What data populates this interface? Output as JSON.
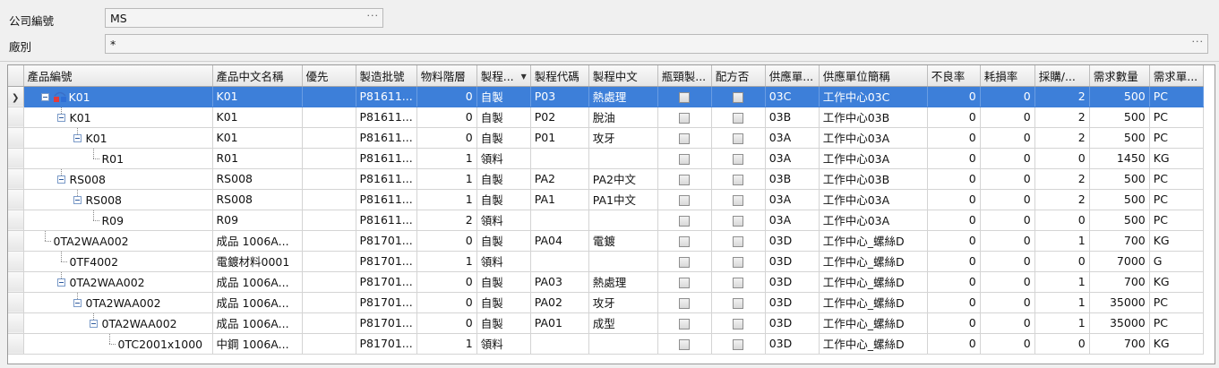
{
  "filters": {
    "company_label": "公司編號",
    "company_value": "MS",
    "plant_label": "廠別",
    "plant_value": "*",
    "ellipsis": "···"
  },
  "grid": {
    "columns": [
      "產品編號",
      "產品中文名稱",
      "優先",
      "製造批號",
      "物料階層",
      "製程...",
      "製程代碼",
      "製程中文",
      "瓶頸製...",
      "配方否",
      "供應單...",
      "供應單位簡稱",
      "不良率",
      "耗損率",
      "採購/...",
      "需求數量",
      "需求單..."
    ],
    "rows": [
      {
        "code": "K01",
        "name": "K01",
        "priority": "",
        "lot": "P81611...",
        "level": "0",
        "ptype": "自製",
        "pcode": "P03",
        "pname": "熱處理",
        "supplier": "03C",
        "supplier_name": "工作中心03C",
        "defect": "0",
        "loss": "0",
        "purchase": "2",
        "qty": "500",
        "unit": "PC"
      },
      {
        "code": "K01",
        "name": "K01",
        "priority": "",
        "lot": "P81611...",
        "level": "0",
        "ptype": "自製",
        "pcode": "P02",
        "pname": "脫油",
        "supplier": "03B",
        "supplier_name": "工作中心03B",
        "defect": "0",
        "loss": "0",
        "purchase": "2",
        "qty": "500",
        "unit": "PC"
      },
      {
        "code": "K01",
        "name": "K01",
        "priority": "",
        "lot": "P81611...",
        "level": "0",
        "ptype": "自製",
        "pcode": "P01",
        "pname": "攻牙",
        "supplier": "03A",
        "supplier_name": "工作中心03A",
        "defect": "0",
        "loss": "0",
        "purchase": "2",
        "qty": "500",
        "unit": "PC"
      },
      {
        "code": "R01",
        "name": "R01",
        "priority": "",
        "lot": "P81611...",
        "level": "1",
        "ptype": "領料",
        "pcode": "",
        "pname": "",
        "supplier": "03A",
        "supplier_name": "工作中心03A",
        "defect": "0",
        "loss": "0",
        "purchase": "0",
        "qty": "1450",
        "unit": "KG"
      },
      {
        "code": "RS008",
        "name": "RS008",
        "priority": "",
        "lot": "P81611...",
        "level": "1",
        "ptype": "自製",
        "pcode": "PA2",
        "pname": "PA2中文",
        "supplier": "03B",
        "supplier_name": "工作中心03B",
        "defect": "0",
        "loss": "0",
        "purchase": "2",
        "qty": "500",
        "unit": "PC"
      },
      {
        "code": "RS008",
        "name": "RS008",
        "priority": "",
        "lot": "P81611...",
        "level": "1",
        "ptype": "自製",
        "pcode": "PA1",
        "pname": "PA1中文",
        "supplier": "03A",
        "supplier_name": "工作中心03A",
        "defect": "0",
        "loss": "0",
        "purchase": "2",
        "qty": "500",
        "unit": "PC"
      },
      {
        "code": "R09",
        "name": "R09",
        "priority": "",
        "lot": "P81611...",
        "level": "2",
        "ptype": "領料",
        "pcode": "",
        "pname": "",
        "supplier": "03A",
        "supplier_name": "工作中心03A",
        "defect": "0",
        "loss": "0",
        "purchase": "0",
        "qty": "500",
        "unit": "PC"
      },
      {
        "code": "0TA2WAA002",
        "name": "成品 1006A...",
        "priority": "",
        "lot": "P81701...",
        "level": "0",
        "ptype": "自製",
        "pcode": "PA04",
        "pname": "電鍍",
        "supplier": "03D",
        "supplier_name": "工作中心_螺絲D",
        "defect": "0",
        "loss": "0",
        "purchase": "1",
        "qty": "700",
        "unit": "KG"
      },
      {
        "code": "0TF4002",
        "name": "電鍍材料0001",
        "priority": "",
        "lot": "P81701...",
        "level": "1",
        "ptype": "領料",
        "pcode": "",
        "pname": "",
        "supplier": "03D",
        "supplier_name": "工作中心_螺絲D",
        "defect": "0",
        "loss": "0",
        "purchase": "0",
        "qty": "7000",
        "unit": "G"
      },
      {
        "code": "0TA2WAA002",
        "name": "成品 1006A...",
        "priority": "",
        "lot": "P81701...",
        "level": "0",
        "ptype": "自製",
        "pcode": "PA03",
        "pname": "熱處理",
        "supplier": "03D",
        "supplier_name": "工作中心_螺絲D",
        "defect": "0",
        "loss": "0",
        "purchase": "1",
        "qty": "700",
        "unit": "KG"
      },
      {
        "code": "0TA2WAA002",
        "name": "成品 1006A...",
        "priority": "",
        "lot": "P81701...",
        "level": "0",
        "ptype": "自製",
        "pcode": "PA02",
        "pname": "攻牙",
        "supplier": "03D",
        "supplier_name": "工作中心_螺絲D",
        "defect": "0",
        "loss": "0",
        "purchase": "1",
        "qty": "35000",
        "unit": "PC"
      },
      {
        "code": "0TA2WAA002",
        "name": "成品 1006A...",
        "priority": "",
        "lot": "P81701...",
        "level": "0",
        "ptype": "自製",
        "pcode": "PA01",
        "pname": "成型",
        "supplier": "03D",
        "supplier_name": "工作中心_螺絲D",
        "defect": "0",
        "loss": "0",
        "purchase": "1",
        "qty": "35000",
        "unit": "PC"
      },
      {
        "code": "0TC2001x1000",
        "name": "中鋼 1006A...",
        "priority": "",
        "lot": "P81701...",
        "level": "1",
        "ptype": "領料",
        "pcode": "",
        "pname": "",
        "supplier": "03D",
        "supplier_name": "工作中心_螺絲D",
        "defect": "0",
        "loss": "0",
        "purchase": "0",
        "qty": "700",
        "unit": "KG"
      }
    ]
  },
  "colors": {
    "selection": "#3d7fd9",
    "tree_expander": "#2d5a9e"
  },
  "icons": {
    "row_pointer": "row-pointer-icon",
    "bom_root": "bom-root-icon",
    "expander": "collapse-icon"
  }
}
